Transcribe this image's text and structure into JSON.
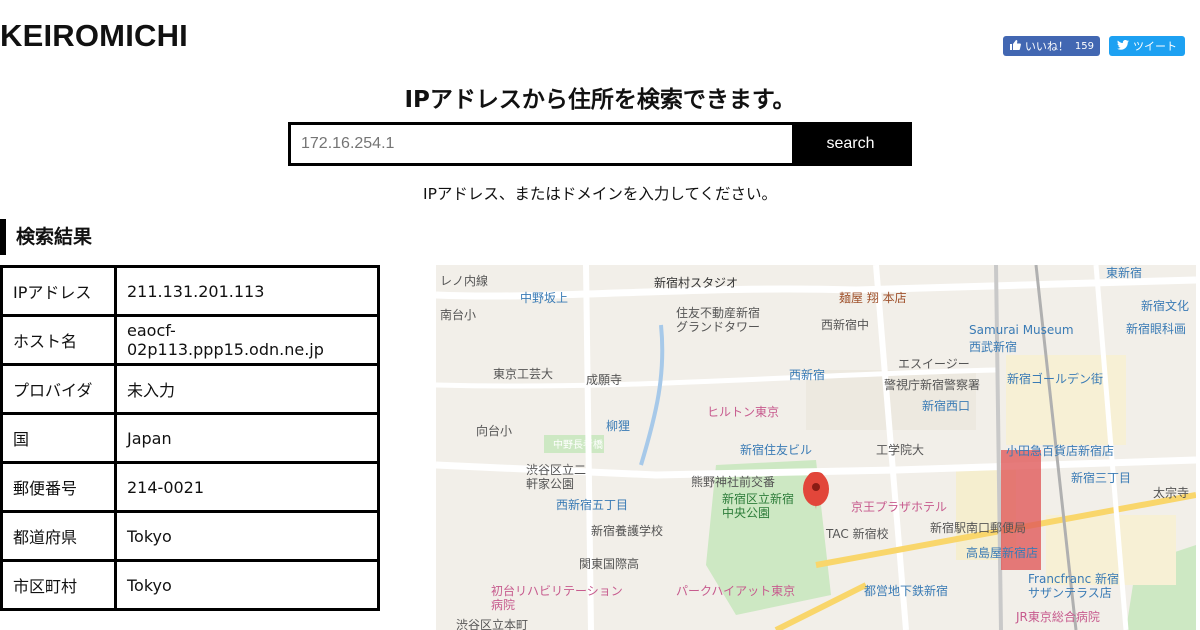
{
  "header": {
    "logo": "KEIROMICHI",
    "fb_like_label": "いいね！",
    "fb_like_count": "159",
    "tweet_label": "ツイート"
  },
  "search": {
    "headline": "IPアドレスから住所を検索できます。",
    "placeholder": "172.16.254.1",
    "button_label": "search",
    "hint": "IPアドレス、またはドメインを入力してください。"
  },
  "results": {
    "title": "検索結果",
    "rows": [
      {
        "key": "IPアドレス",
        "value": "211.131.201.113"
      },
      {
        "key": "ホスト名",
        "value": "eaocf-02p113.ppp15.odn.ne.jp"
      },
      {
        "key": "プロバイダ",
        "value": "未入力"
      },
      {
        "key": "国",
        "value": "Japan"
      },
      {
        "key": "郵便番号",
        "value": "214-0021"
      },
      {
        "key": "都道府県",
        "value": "Tokyo"
      },
      {
        "key": "市区町村",
        "value": "Tokyo"
      }
    ]
  },
  "map": {
    "labels": {
      "nakano_ward": "レノ内線",
      "nakano_sakaue": "中野坂上",
      "shinjuku_studio": "新宿村スタジオ",
      "menya_sho": "麺屋 翔 本店",
      "higashi_shinjuku": "東新宿",
      "shinjuku_bunka": "新宿文化",
      "sumitomo_grand": "住友不動産新宿\nグランドタワー",
      "nishishinjuku_naka": "西新宿中",
      "samurai_museum": "Samurai Museum",
      "shinjuku_ganka": "新宿眼科画",
      "seibu_shinjuku": "西武新宿",
      "minamidai": "南台小",
      "tokyo_kogei": "東京工芸大",
      "seiganji": "成願寺",
      "nishi_shinjuku_st": "西新宿",
      "keishicho": "警視庁新宿警察署",
      "s_ks": "エスイージー",
      "golden_gai": "新宿ゴールデン街",
      "shinjuku_nishiguchi": "新宿西口",
      "hilton": "ヒルトン東京",
      "yanagi": "柳狸",
      "mukodai": "向台小",
      "nakano_chohashi": "中野長者橋",
      "sumitomo_bldg": "新宿住友ビル",
      "kogakuin": "工学院大",
      "odakyu": "小田急百貨店新宿店",
      "shibuya_kuritsu": "渋谷区立二\n軒家公園",
      "kumano": "熊野神社前交番",
      "shinjuku_chuo_park": "新宿区立新宿\n中央公園",
      "shinjuku_3chome": "新宿三丁目",
      "nishishinjuku_5": "西新宿五丁目",
      "keio_plaza": "京王プラザホテル",
      "shinjuku_yosei": "新宿養護学校",
      "tac": "TAC 新宿校",
      "shinjuku_post": "新宿駅南口郵便局",
      "takashimaya": "高島屋新宿店",
      "kanto_kokusai": "関東国際高",
      "hatsudai": "初台リハビリテーション\n病院",
      "park_hyatt": "パークハイアット東京",
      "toei": "都営地下鉄新宿",
      "francfranc": "Francfranc 新宿\nサザンテラス店",
      "jr_hospital": "JR東京総合病院",
      "shibuya_honmachi": "渋谷区立本町",
      "taiso": "太宗寺"
    }
  }
}
